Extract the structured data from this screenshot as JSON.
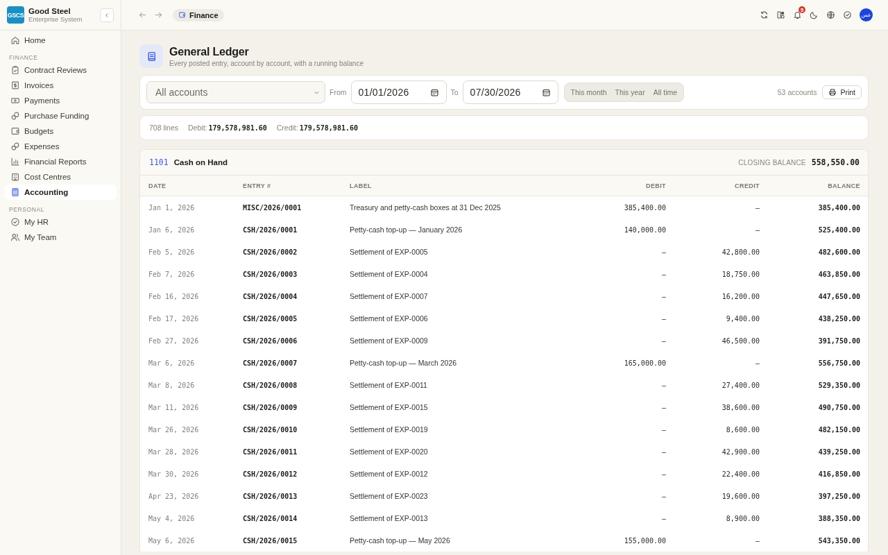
{
  "sidebar": {
    "brand": {
      "logo": "GSCS",
      "name": "Good Steel",
      "subtitle": "Enterprise System"
    },
    "sections": [
      {
        "items": [
          {
            "label": "Home",
            "selected": false
          }
        ]
      },
      {
        "heading": "FINANCE",
        "items": [
          {
            "label": "Contract Reviews",
            "selected": false
          },
          {
            "label": "Invoices",
            "selected": false
          },
          {
            "label": "Payments",
            "selected": false
          },
          {
            "label": "Purchase Funding",
            "selected": false
          },
          {
            "label": "Budgets",
            "selected": false
          },
          {
            "label": "Expenses",
            "selected": false
          },
          {
            "label": "Financial Reports",
            "selected": false
          },
          {
            "label": "Cost Centres",
            "selected": false
          },
          {
            "label": "Accounting",
            "selected": true
          }
        ]
      },
      {
        "heading": "PERSONAL",
        "items": [
          {
            "label": "My HR",
            "selected": false
          },
          {
            "label": "My Team",
            "selected": false
          }
        ]
      }
    ]
  },
  "topbar": {
    "breadcrumb": "Finance",
    "notifications": "5",
    "avatar": "عس"
  },
  "page": {
    "title": "General Ledger",
    "subtitle": "Every posted entry, account by account, with a running balance"
  },
  "filters": {
    "account": "All accounts",
    "from_label": "From",
    "from": "01/01/2026",
    "to_label": "To",
    "to": "07/30/2026",
    "presets": [
      {
        "label": "This month",
        "selected": false
      },
      {
        "label": "This year",
        "selected": false
      },
      {
        "label": "All time",
        "selected": false
      }
    ],
    "count": "53 accounts",
    "print": "Print"
  },
  "summary": {
    "lines": "708 lines",
    "debit_label": "Debit:",
    "debit": "179,578,981.60",
    "credit_label": "Credit:",
    "credit": "179,578,981.60"
  },
  "account": {
    "code": "1101",
    "name": "Cash on Hand",
    "closing_label": "CLOSING BALANCE",
    "closing": "558,550.00",
    "columns": [
      "DATE",
      "ENTRY #",
      "LABEL",
      "DEBIT",
      "CREDIT",
      "BALANCE"
    ],
    "rows": [
      {
        "date": "Jan 1, 2026",
        "entry": "MISC/2026/0001",
        "label": "Treasury and petty-cash boxes at 31 Dec 2025",
        "debit": "385,400.00",
        "credit": "—",
        "balance": "385,400.00"
      },
      {
        "date": "Jan 6, 2026",
        "entry": "CSH/2026/0001",
        "label": "Petty-cash top-up — January 2026",
        "debit": "140,000.00",
        "credit": "—",
        "balance": "525,400.00"
      },
      {
        "date": "Feb 5, 2026",
        "entry": "CSH/2026/0002",
        "label": "Settlement of EXP-0005",
        "debit": "—",
        "credit": "42,800.00",
        "balance": "482,600.00"
      },
      {
        "date": "Feb 7, 2026",
        "entry": "CSH/2026/0003",
        "label": "Settlement of EXP-0004",
        "debit": "—",
        "credit": "18,750.00",
        "balance": "463,850.00"
      },
      {
        "date": "Feb 16, 2026",
        "entry": "CSH/2026/0004",
        "label": "Settlement of EXP-0007",
        "debit": "—",
        "credit": "16,200.00",
        "balance": "447,650.00"
      },
      {
        "date": "Feb 17, 2026",
        "entry": "CSH/2026/0005",
        "label": "Settlement of EXP-0006",
        "debit": "—",
        "credit": "9,400.00",
        "balance": "438,250.00"
      },
      {
        "date": "Feb 27, 2026",
        "entry": "CSH/2026/0006",
        "label": "Settlement of EXP-0009",
        "debit": "—",
        "credit": "46,500.00",
        "balance": "391,750.00"
      },
      {
        "date": "Mar 6, 2026",
        "entry": "CSH/2026/0007",
        "label": "Petty-cash top-up — March 2026",
        "debit": "165,000.00",
        "credit": "—",
        "balance": "556,750.00"
      },
      {
        "date": "Mar 8, 2026",
        "entry": "CSH/2026/0008",
        "label": "Settlement of EXP-0011",
        "debit": "—",
        "credit": "27,400.00",
        "balance": "529,350.00"
      },
      {
        "date": "Mar 11, 2026",
        "entry": "CSH/2026/0009",
        "label": "Settlement of EXP-0015",
        "debit": "—",
        "credit": "38,600.00",
        "balance": "490,750.00"
      },
      {
        "date": "Mar 26, 2026",
        "entry": "CSH/2026/0010",
        "label": "Settlement of EXP-0019",
        "debit": "—",
        "credit": "8,600.00",
        "balance": "482,150.00"
      },
      {
        "date": "Mar 28, 2026",
        "entry": "CSH/2026/0011",
        "label": "Settlement of EXP-0020",
        "debit": "—",
        "credit": "42,900.00",
        "balance": "439,250.00"
      },
      {
        "date": "Mar 30, 2026",
        "entry": "CSH/2026/0012",
        "label": "Settlement of EXP-0012",
        "debit": "—",
        "credit": "22,400.00",
        "balance": "416,850.00"
      },
      {
        "date": "Apr 23, 2026",
        "entry": "CSH/2026/0013",
        "label": "Settlement of EXP-0023",
        "debit": "—",
        "credit": "19,600.00",
        "balance": "397,250.00"
      },
      {
        "date": "May 4, 2026",
        "entry": "CSH/2026/0014",
        "label": "Settlement of EXP-0013",
        "debit": "—",
        "credit": "8,900.00",
        "balance": "388,350.00"
      },
      {
        "date": "May 6, 2026",
        "entry": "CSH/2026/0015",
        "label": "Petty-cash top-up — May 2026",
        "debit": "155,000.00",
        "credit": "—",
        "balance": "543,350.00"
      }
    ]
  }
}
